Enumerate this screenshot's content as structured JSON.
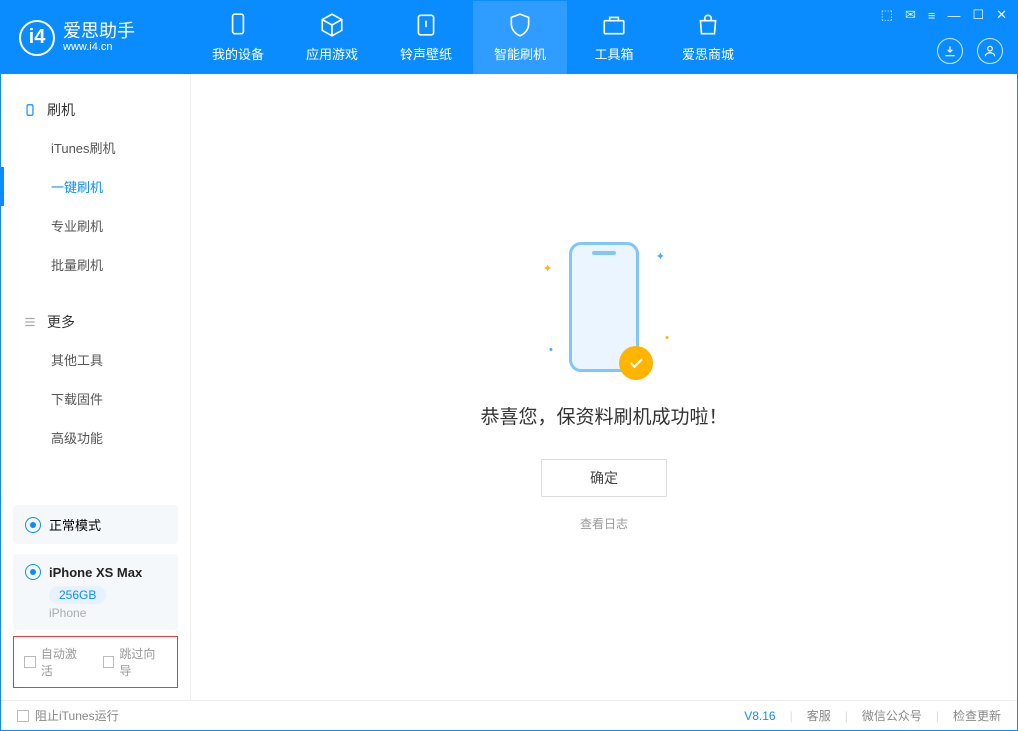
{
  "app": {
    "name": "爱思助手",
    "url": "www.i4.cn"
  },
  "nav": [
    {
      "label": "我的设备",
      "icon": "device"
    },
    {
      "label": "应用游戏",
      "icon": "cube"
    },
    {
      "label": "铃声壁纸",
      "icon": "music"
    },
    {
      "label": "智能刷机",
      "icon": "shield",
      "active": true
    },
    {
      "label": "工具箱",
      "icon": "toolbox"
    },
    {
      "label": "爱思商城",
      "icon": "bag"
    }
  ],
  "sidebar": {
    "group1": {
      "title": "刷机",
      "items": [
        "iTunes刷机",
        "一键刷机",
        "专业刷机",
        "批量刷机"
      ],
      "activeIndex": 1
    },
    "group2": {
      "title": "更多",
      "items": [
        "其他工具",
        "下载固件",
        "高级功能"
      ]
    }
  },
  "mode_card": {
    "label": "正常模式"
  },
  "device_card": {
    "name": "iPhone XS Max",
    "storage": "256GB",
    "type": "iPhone"
  },
  "checkboxes": {
    "auto_activate": "自动激活",
    "skip_guide": "跳过向导"
  },
  "main": {
    "success_title": "恭喜您，保资料刷机成功啦！",
    "ok_button": "确定",
    "view_log": "查看日志"
  },
  "footer": {
    "block_itunes": "阻止iTunes运行",
    "version": "V8.16",
    "links": [
      "客服",
      "微信公众号",
      "检查更新"
    ]
  }
}
